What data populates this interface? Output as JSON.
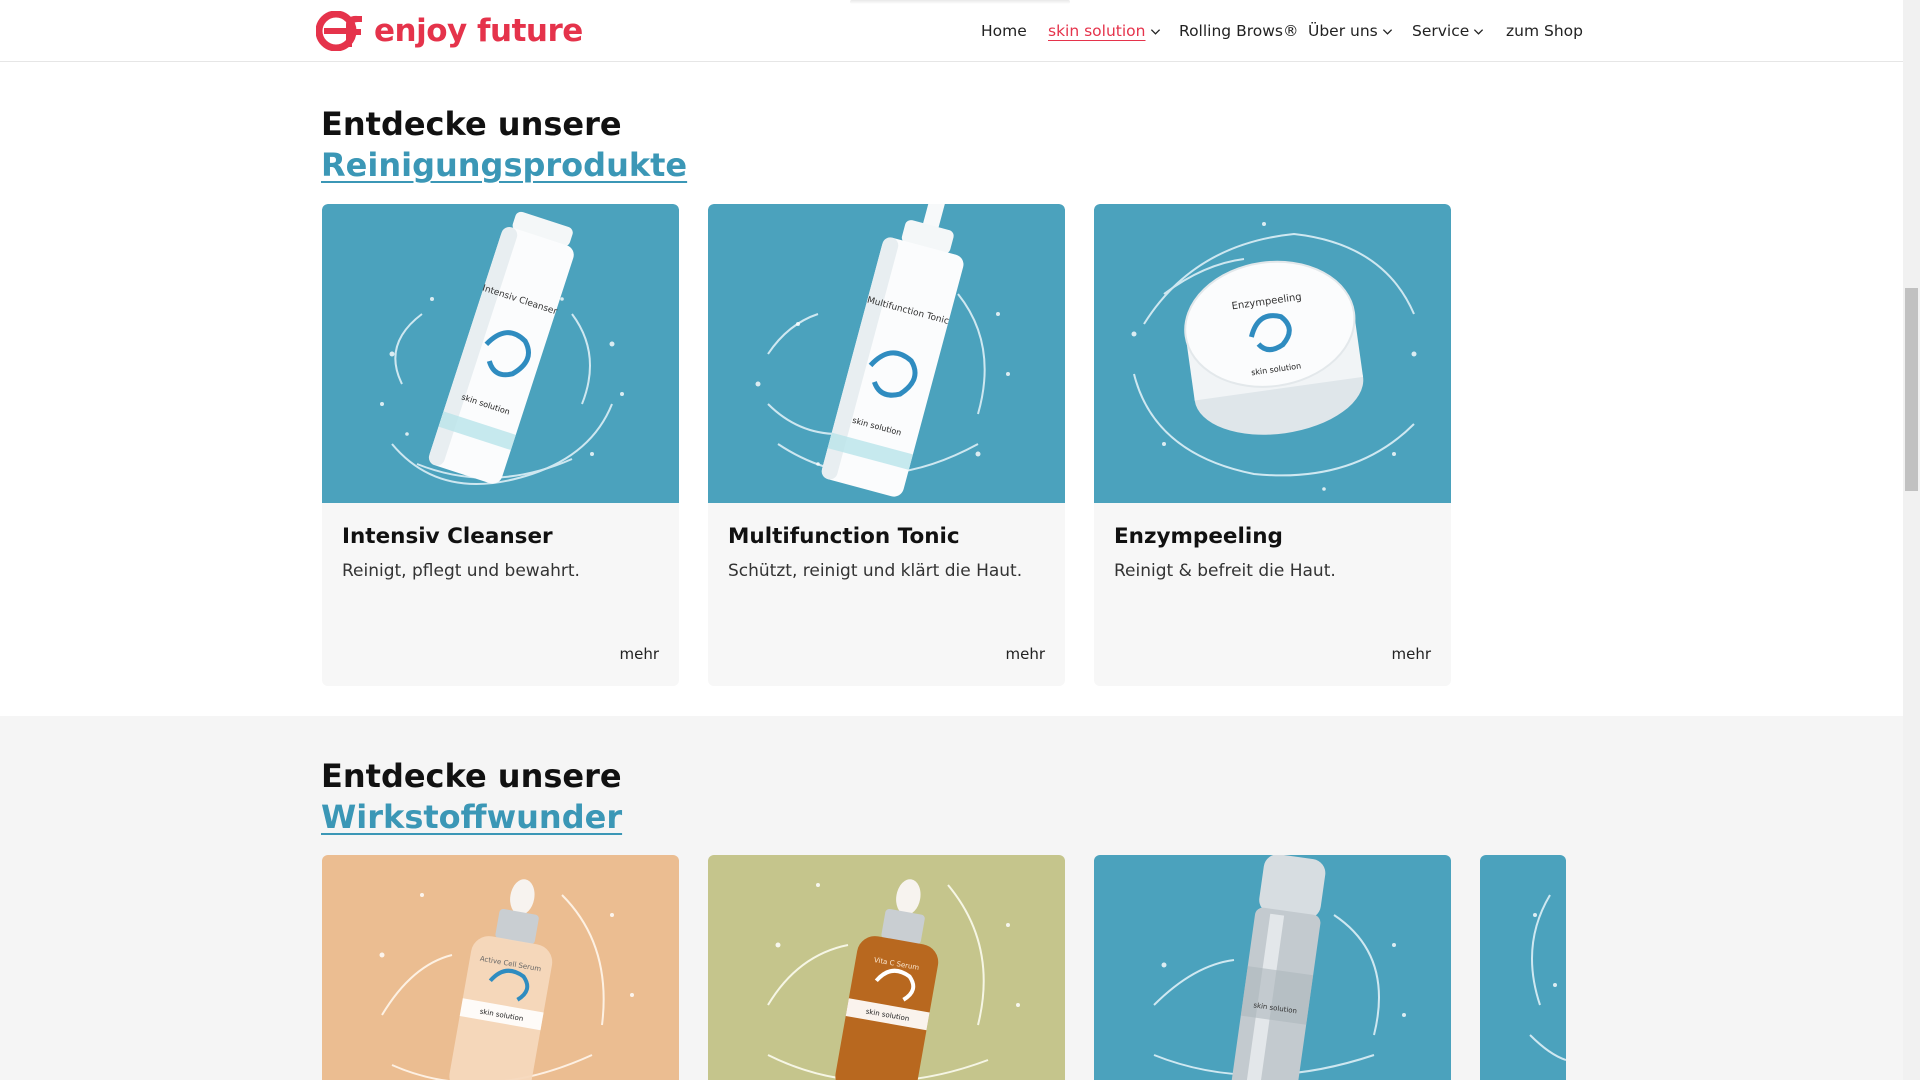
{
  "header": {
    "logo_text": "enjoy future",
    "brand_color": "#e5334b",
    "nav": [
      {
        "label": "Home",
        "has_dropdown": false,
        "active": false
      },
      {
        "label": "skin solution",
        "has_dropdown": true,
        "active": true
      },
      {
        "label": "Rolling Brows®",
        "has_dropdown": false,
        "active": false
      },
      {
        "label": "Über uns",
        "has_dropdown": true,
        "active": false
      },
      {
        "label": "Service",
        "has_dropdown": true,
        "active": false
      },
      {
        "label": "zum Shop",
        "has_dropdown": false,
        "active": false
      }
    ]
  },
  "section1": {
    "title_line1": "Entdecke unsere",
    "title_link": "Reinigungsprodukte",
    "cards": [
      {
        "title": "Intensiv Cleanser",
        "desc": "Reinigt, pflegt und bewahrt.",
        "more": "mehr",
        "product_label": "Intensiv Cleanser",
        "brand": "skin solution"
      },
      {
        "title": "Multifunction Tonic",
        "desc": "Schützt, reinigt und klärt die Haut.",
        "more": "mehr",
        "product_label": "Multifunction Tonic",
        "brand": "skin solution"
      },
      {
        "title": "Enzympeeling",
        "desc": "Reinigt & befreit die Haut.",
        "more": "mehr",
        "product_label": "Enzympeeling",
        "brand": "skin solution"
      }
    ]
  },
  "section2": {
    "title_line1": "Entdecke unsere",
    "title_link": "Wirkstoffwunder",
    "cards": [
      {
        "bg": "#ebbd91",
        "product_label": "Active Cell Serum",
        "brand": "skin solution"
      },
      {
        "bg": "#c5c58c",
        "product_label": "Vita C Serum",
        "brand": "skin solution"
      },
      {
        "bg": "#4ba2bd",
        "product_label": "",
        "brand": "skin solution"
      },
      {
        "bg": "#4ba2bd",
        "product_label": "",
        "brand": ""
      }
    ]
  },
  "colors": {
    "teal": "#4ba2bd",
    "link": "#3b97b6",
    "brand": "#e5334b"
  }
}
